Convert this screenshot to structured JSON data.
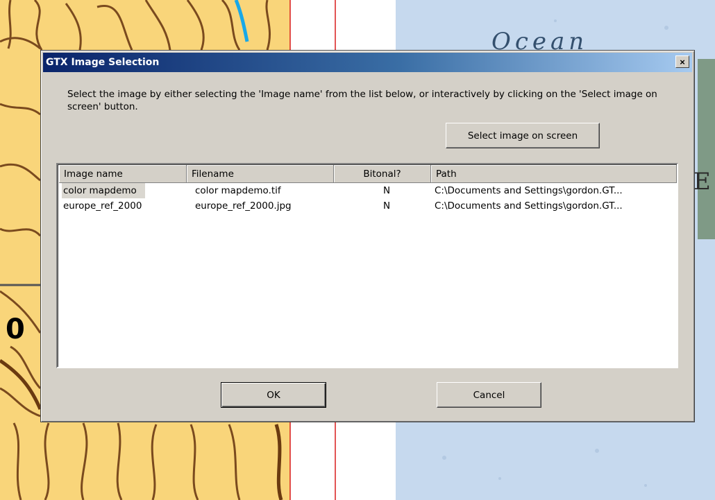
{
  "map": {
    "label_ocean": "Ocean",
    "label_edge_letter": "E",
    "label_contour": "0",
    "colors": {
      "land": "#f9d57a",
      "contour": "#7a4a1e",
      "ocean": "#c6d9ee",
      "river": "#18a8e8",
      "boundary": "#d81c1c"
    }
  },
  "dialog": {
    "title": "GTX Image Selection",
    "close_label": "×",
    "instructions": "Select the image by either selecting the 'Image name' from the list below, or interactively by clicking on the 'Select image on screen' button.",
    "select_on_screen_label": "Select image on screen",
    "ok_label": "OK",
    "cancel_label": "Cancel",
    "columns": [
      "Image name",
      "Filename",
      "Bitonal?",
      "Path"
    ],
    "rows": [
      {
        "image_name": "color mapdemo",
        "filename": "color mapdemo.tif",
        "bitonal": "N",
        "path": "C:\\Documents and Settings\\gordon.GT...",
        "selected": true
      },
      {
        "image_name": "europe_ref_2000",
        "filename": "europe_ref_2000.jpg",
        "bitonal": "N",
        "path": "C:\\Documents and Settings\\gordon.GT...",
        "selected": false
      }
    ]
  }
}
